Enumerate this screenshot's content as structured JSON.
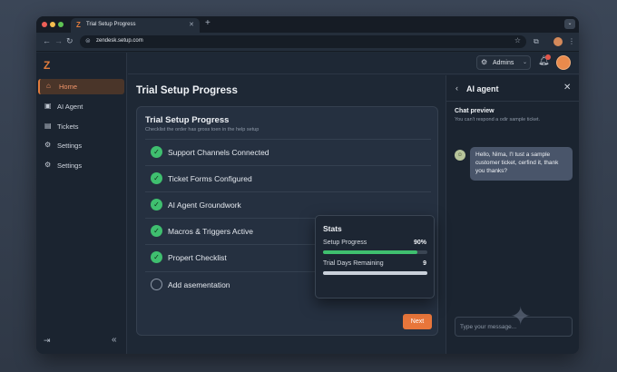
{
  "browser": {
    "tab_title": "Trial Setup Progress",
    "tab_logo": "Z",
    "new_tab": "+",
    "tab_menu": "⌄",
    "url": "zendesk.setup.com"
  },
  "sidebar": {
    "logo": "Z",
    "items": [
      {
        "label": "Home",
        "icon": "home-icon",
        "glyph": "⌂",
        "active": true
      },
      {
        "label": "AI Agent",
        "icon": "ai-agent-icon",
        "glyph": "▣",
        "active": false
      },
      {
        "label": "Tickets",
        "icon": "tickets-icon",
        "glyph": "▤",
        "active": false
      },
      {
        "label": "Settings",
        "icon": "settings-icon",
        "glyph": "⚙",
        "active": false
      },
      {
        "label": "Settings",
        "icon": "settings-icon",
        "glyph": "⚙",
        "active": false
      }
    ]
  },
  "header": {
    "admins_label": "Admins"
  },
  "main": {
    "page_title": "Trial Setup Progress",
    "card": {
      "title": "Trial Setup Progress",
      "subtitle": "Checklist the order has gross toen in the help setup",
      "items": [
        {
          "label": "Support Channels Connected",
          "done": true
        },
        {
          "label": "Ticket Forms Configured",
          "done": true
        },
        {
          "label": "AI Agent Groundwork",
          "done": true
        },
        {
          "label": "Macros & Triggers Active",
          "done": true
        },
        {
          "label": "Propert Checklist",
          "done": true
        },
        {
          "label": "Add asementation",
          "done": false
        }
      ],
      "next_label": "Next"
    }
  },
  "stats": {
    "title": "Stats",
    "setup_progress": {
      "label": "Setup Progress",
      "value": "90%",
      "fill": 0.9
    },
    "trial_days": {
      "label": "Trial Days Remaining",
      "value": "9",
      "fill": 1.0
    }
  },
  "chat": {
    "title": "AI agent",
    "preview_title": "Chat preview",
    "preview_note": "You can't respond a odir sample ticket.",
    "message": "Hello, Nima, I'l tust a sample customer ticket, cerfind it, thank you thanks?",
    "input_placeholder": "Type your message..."
  },
  "colors": {
    "accent": "#e8763b",
    "success": "#3fbf6f",
    "stats_progress_fill": "#3fbf6f",
    "stats_days_fill": "#c9d0da"
  }
}
